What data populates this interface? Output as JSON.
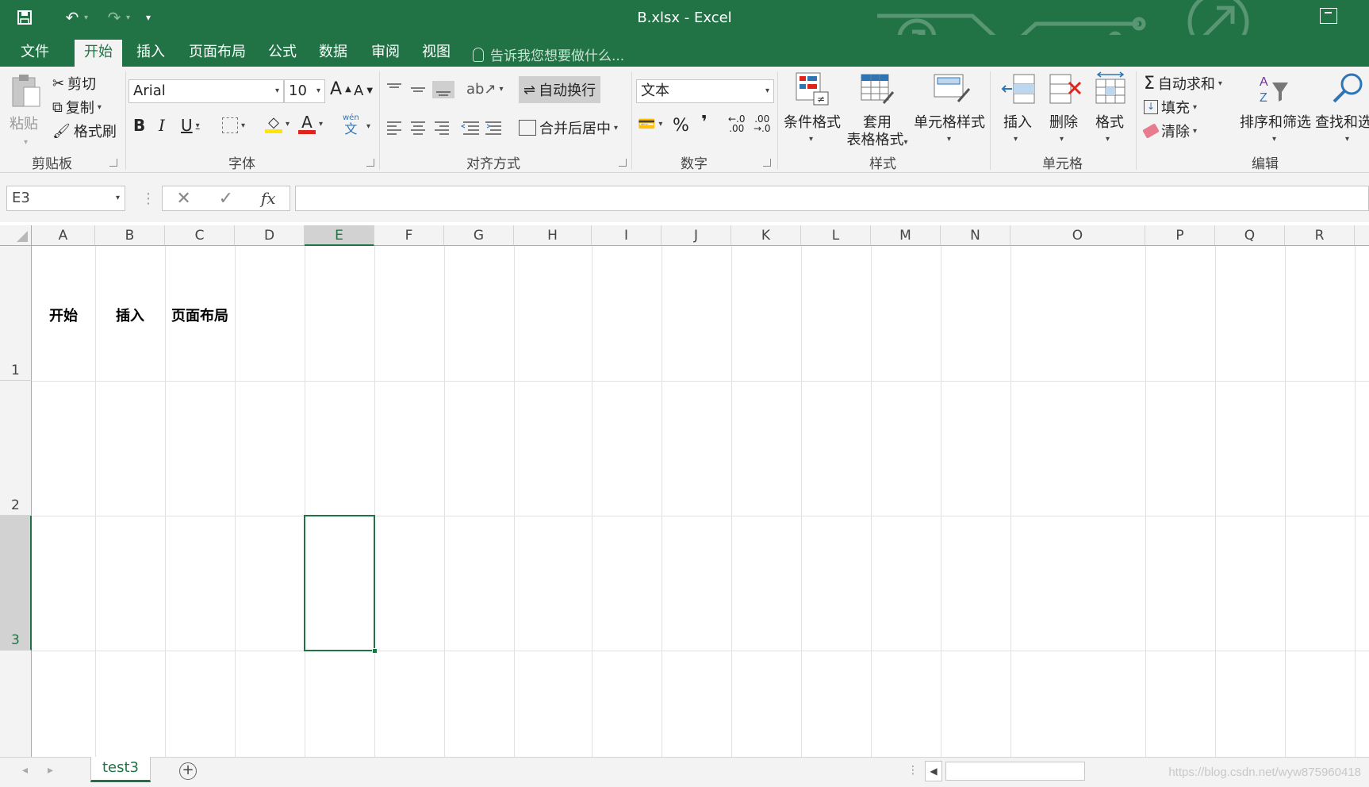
{
  "window": {
    "title": "B.xlsx - Excel",
    "accent_color": "#217346"
  },
  "qat": {
    "save_icon": "save-icon",
    "undo_icon": "undo-icon",
    "redo_icon": "redo-icon",
    "customize_icon": "customize-qat-icon"
  },
  "menu": {
    "tabs": [
      {
        "label": "文件"
      },
      {
        "label": "开始"
      },
      {
        "label": "插入"
      },
      {
        "label": "页面布局"
      },
      {
        "label": "公式"
      },
      {
        "label": "数据"
      },
      {
        "label": "审阅"
      },
      {
        "label": "视图"
      }
    ],
    "active_tab": "开始",
    "tell_me": "告诉我您想要做什么..."
  },
  "ribbon": {
    "clipboard": {
      "label": "剪贴板",
      "paste": "粘贴",
      "cut": "剪切",
      "copy": "复制",
      "format_painter": "格式刷"
    },
    "font": {
      "label": "字体",
      "font_name": "Arial",
      "font_size": "10",
      "bold": "B",
      "italic": "I",
      "underline": "U",
      "font_color_glyph": "A",
      "font_color": "#e0231c",
      "fill_color": "#ffe600",
      "grow": "A",
      "shrink": "A",
      "pinyin_top": "wén",
      "pinyin_bottom": "文"
    },
    "alignment": {
      "label": "对齐方式",
      "wrap_text": "自动换行",
      "merge_center": "合并后居中"
    },
    "number": {
      "label": "数字",
      "format": "文本",
      "percent": "%",
      "comma": "❜",
      "inc_decimal_top": "←.0",
      "inc_decimal_bottom": ".00",
      "dec_decimal_top": ".00",
      "dec_decimal_bottom": "→.0"
    },
    "styles": {
      "label": "样式",
      "conditional": "条件格式",
      "table_line1": "套用",
      "table_line2": "表格格式",
      "cell_styles": "单元格样式"
    },
    "cells": {
      "label": "单元格",
      "insert": "插入",
      "delete": "删除",
      "format": "格式"
    },
    "editing": {
      "label": "编辑",
      "autosum": "自动求和",
      "fill": "填充",
      "clear": "清除",
      "sort_filter": "排序和筛选",
      "find_select": "查找和选"
    }
  },
  "formula_bar": {
    "name_box": "E3",
    "cancel": "✕",
    "enter": "✓",
    "fx": "fx",
    "value": ""
  },
  "grid": {
    "columns": [
      "A",
      "B",
      "C",
      "D",
      "E",
      "F",
      "G",
      "H",
      "I",
      "J",
      "K",
      "L",
      "M",
      "N",
      "O",
      "P",
      "Q",
      "R"
    ],
    "rows": [
      "1",
      "2",
      "3"
    ],
    "selected_column": "E",
    "selected_row": "3",
    "cells": {
      "A1": "开始",
      "B1": "插入",
      "C1": "页面布局"
    }
  },
  "sheets": {
    "tabs": [
      "test3"
    ],
    "active": "test3",
    "add_icon": "add-sheet-icon"
  },
  "watermark": "https://blog.csdn.net/wyw875960418"
}
